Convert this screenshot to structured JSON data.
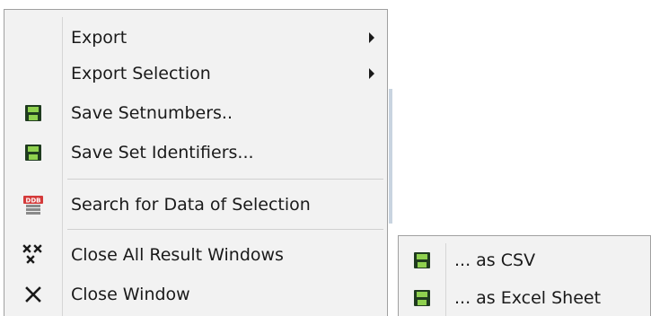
{
  "main_menu": {
    "items": [
      {
        "label": "Export",
        "icon": "",
        "submenu": true
      },
      {
        "label": "Export Selection",
        "icon": "",
        "submenu": true
      },
      {
        "label": "Save Setnumbers..",
        "icon": "floppy-disk-icon"
      },
      {
        "label": "Save Set Identifiers...",
        "icon": "floppy-disk-icon"
      },
      {
        "label": "Search for Data of Selection",
        "icon": "ddb-database-icon"
      },
      {
        "label": "Close All Result Windows",
        "icon": "close-all-icon"
      },
      {
        "label": "Close Window",
        "icon": "close-icon"
      }
    ],
    "ddb_badge": "DDB"
  },
  "sub_menu": {
    "items": [
      {
        "label": "... as CSV",
        "icon": "floppy-disk-icon"
      },
      {
        "label": "... as Excel Sheet",
        "icon": "floppy-disk-icon"
      }
    ]
  },
  "colors": {
    "menu_bg": "#f2f2f2",
    "border": "#a0a0a0",
    "floppy_dark": "#1f3b1f",
    "floppy_green": "#7fc241",
    "ddb_red": "#d43a3a"
  }
}
